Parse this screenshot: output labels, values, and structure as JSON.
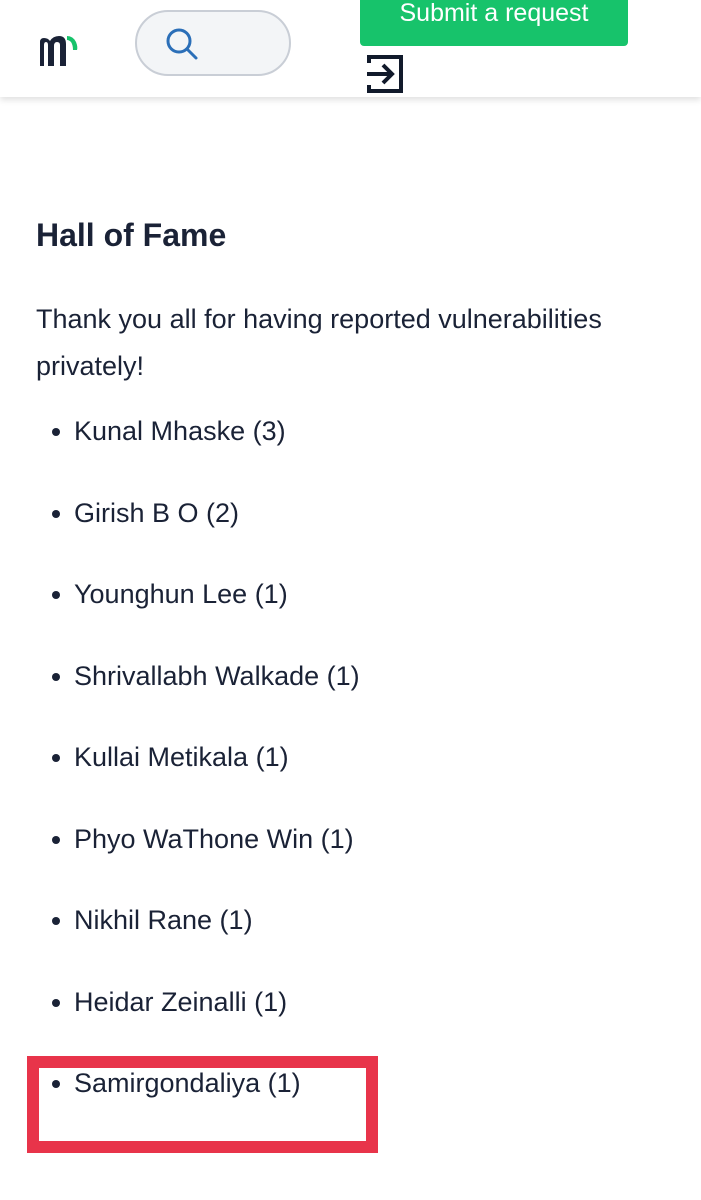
{
  "header": {
    "logo_alt": "m",
    "submit_label": "Submit a request"
  },
  "colors": {
    "accent_green": "#17c36b",
    "logo_dark": "#1a2236",
    "highlight_red": "#e8344a"
  },
  "icons": {
    "search": "search-icon",
    "signin": "sign-in-icon"
  },
  "article": {
    "title": "Hall of Fame",
    "intro": "Thank you all for having reported vulnerabilities privately!",
    "entries": [
      "Kunal Mhaske (3)",
      "Girish B O (2)",
      "Younghun Lee (1)",
      "Shrivallabh Walkade (1)",
      "Kullai Metikala (1)",
      "Phyo WaThone Win (1)",
      "Nikhil Rane (1)",
      "Heidar Zeinalli (1)",
      "Samirgondaliya (1)"
    ]
  }
}
